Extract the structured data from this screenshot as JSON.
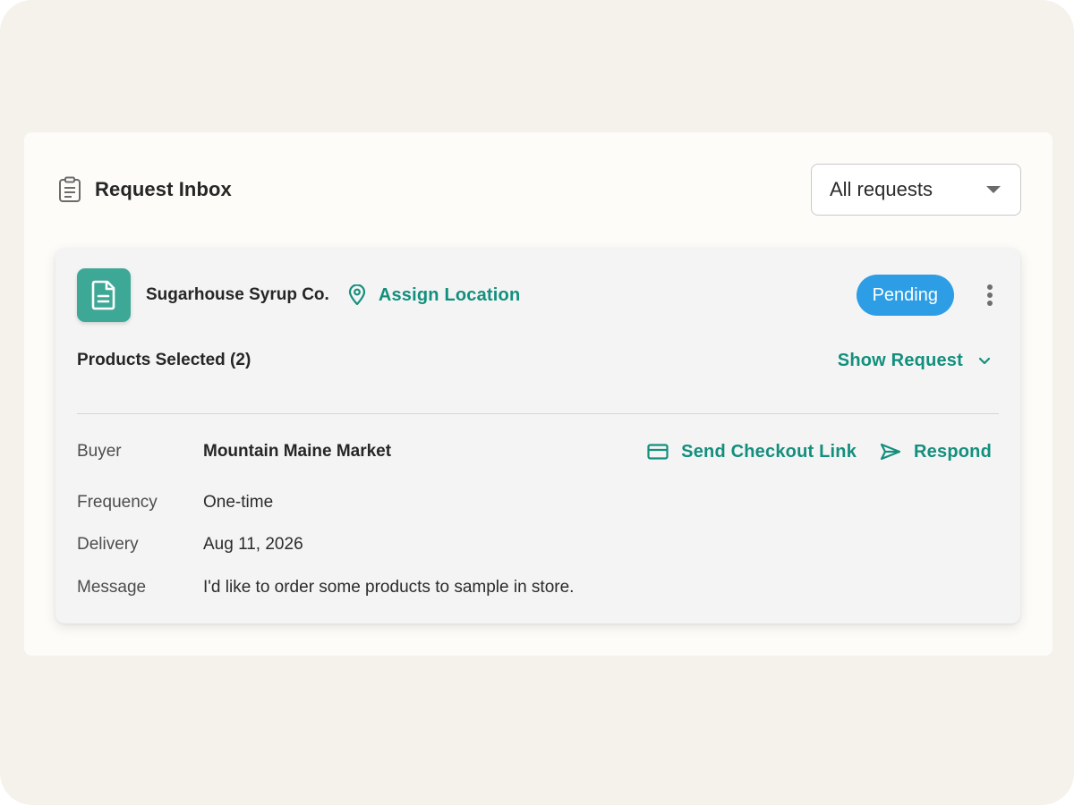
{
  "inbox": {
    "title": "Request Inbox",
    "title_icon": "clipboard-icon",
    "filter": {
      "selected": "All requests",
      "icon": "caret-down-icon"
    }
  },
  "request": {
    "vendor": "Sugarhouse Syrup Co.",
    "vendor_icon": "document-icon",
    "assign_location_label": "Assign Location",
    "status": "Pending",
    "products_selected_label": "Products Selected (2)",
    "show_request_label": "Show Request",
    "details": {
      "buyer_label": "Buyer",
      "buyer_value": "Mountain Maine Market",
      "frequency_label": "Frequency",
      "frequency_value": "One-time",
      "delivery_label": "Delivery",
      "delivery_value": "Aug 11, 2026",
      "message_label": "Message",
      "message_value": "I'd like to order some products to sample in store."
    },
    "actions": {
      "send_checkout_label": "Send Checkout Link",
      "respond_label": "Respond"
    }
  },
  "colors": {
    "accent": "#138f7d",
    "badge_green": "#3ea897",
    "status_blue": "#2d9ee5",
    "background": "#f5f1eb"
  }
}
